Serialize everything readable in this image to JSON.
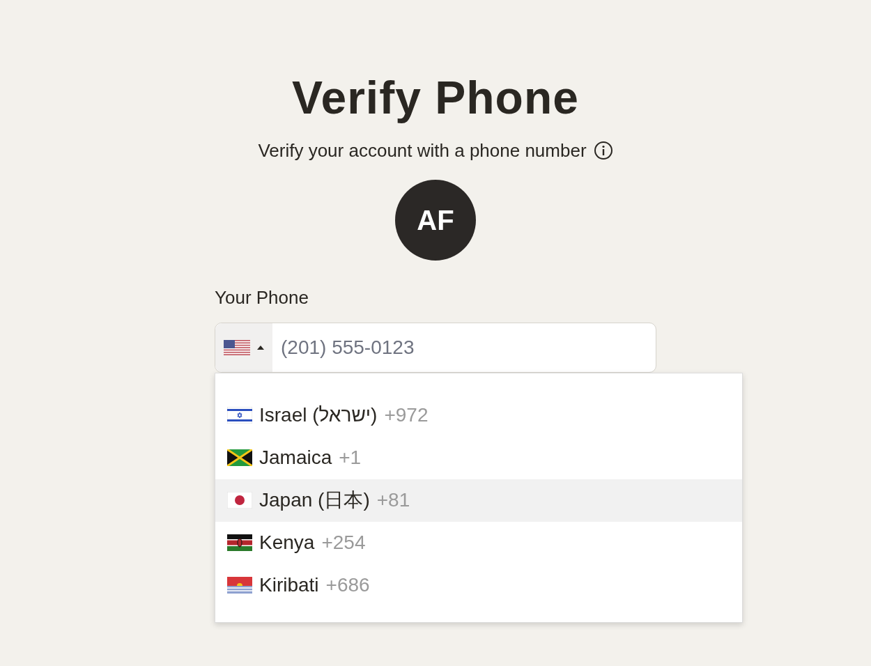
{
  "title": "Verify Phone",
  "subtitle": "Verify your account with a phone number",
  "avatar": {
    "initials": "AF"
  },
  "phone": {
    "label": "Your Phone",
    "placeholder": "(201) 555-0123",
    "country_menu_expanded": true
  },
  "countries": [
    {
      "name": "Israel (ישראל)",
      "code": "+972",
      "selected": false
    },
    {
      "name": "Jamaica",
      "code": "+1",
      "selected": false
    },
    {
      "name": "Japan (日本)",
      "code": "+81",
      "selected": true
    },
    {
      "name": "Kenya",
      "code": "+254",
      "selected": false
    },
    {
      "name": "Kiribati",
      "code": "+686",
      "selected": false
    }
  ]
}
